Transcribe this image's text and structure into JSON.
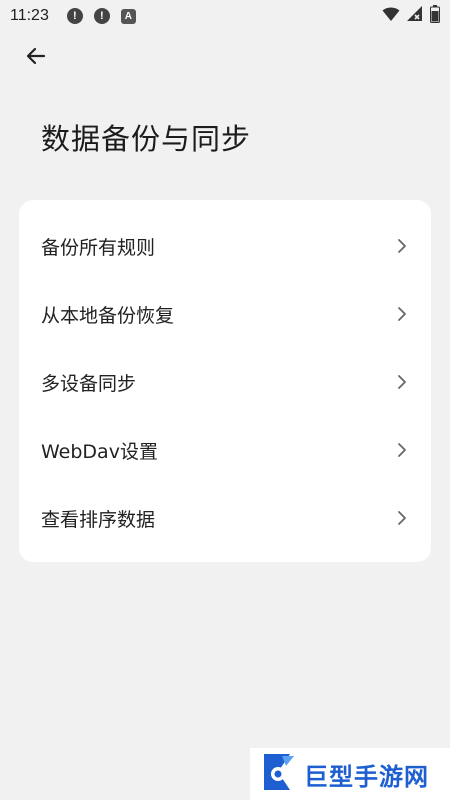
{
  "status_bar": {
    "time": "11:23",
    "notifications": [
      {
        "icon": "alert-icon",
        "glyph": "!"
      },
      {
        "icon": "alert-icon",
        "glyph": "!"
      },
      {
        "icon": "a-badge-icon",
        "glyph": "A"
      }
    ],
    "right_icons": [
      "wifi-icon",
      "signal-icon",
      "battery-icon"
    ]
  },
  "header": {
    "back_icon": "arrow-left-icon",
    "title": "数据备份与同步"
  },
  "menu": {
    "items": [
      {
        "label": "备份所有规则"
      },
      {
        "label": "从本地备份恢复"
      },
      {
        "label": "多设备同步"
      },
      {
        "label": "WebDav设置"
      },
      {
        "label": "查看排序数据"
      }
    ]
  },
  "watermark": {
    "text": "巨型手游网"
  },
  "colors": {
    "background": "#f1f1f1",
    "card": "#ffffff",
    "watermark_blue": "#1d5fd1"
  }
}
